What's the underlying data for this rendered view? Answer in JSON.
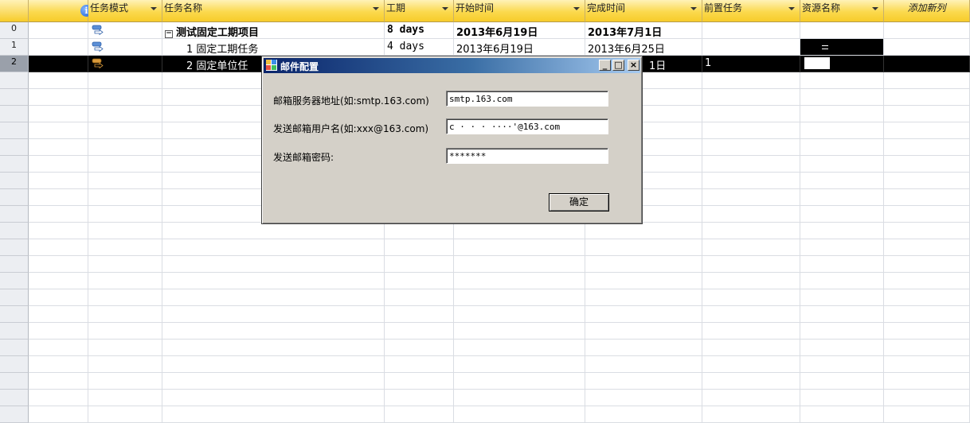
{
  "header": {
    "columns": [
      {
        "label": ""
      },
      {
        "label": "任务模式"
      },
      {
        "label": "任务名称"
      },
      {
        "label": "工期"
      },
      {
        "label": "开始时间"
      },
      {
        "label": "完成时间"
      },
      {
        "label": "前置任务"
      },
      {
        "label": "资源名称"
      },
      {
        "label": "添加新列"
      }
    ]
  },
  "rows": [
    {
      "num": "0",
      "name": "测试固定工期项目",
      "duration": "8 days",
      "start": "2013年6月19日",
      "finish": "2013年7月1日",
      "predecessors": "",
      "resource": ""
    },
    {
      "num": "1",
      "name": "1  固定工期任务",
      "duration": "4 days",
      "start": "2013年6月19日",
      "finish": "2013年6月25日",
      "predecessors": "",
      "resource": ""
    },
    {
      "num": "2",
      "name": "2  固定单位任",
      "duration": "",
      "start": "",
      "finish": "1日",
      "predecessors": "1",
      "resource": ""
    }
  ],
  "empty_row_count": 22,
  "dialog": {
    "title": "邮件配置",
    "server_label": "邮箱服务器地址(如:smtp.163.com)",
    "server_value": "smtp.163.com",
    "user_label": "发送邮箱用户名(如:xxx@163.com)",
    "user_value": "c · · · ····'@163.com",
    "password_label": "发送邮箱密码:",
    "password_value": "*******",
    "ok_label": "确定"
  },
  "colors": {
    "header_gold": "#fbd94e",
    "selected_row": "#000000",
    "dialog_face": "#d4d0c8",
    "title_dark": "#0a246a",
    "title_light": "#a6caf0"
  },
  "icons": {
    "info": "info-icon",
    "task_mode_auto": "auto-schedule-icon",
    "task_mode_manual": "manual-schedule-icon",
    "collapse": "collapse-toggle-icon",
    "title": "app-icon"
  }
}
